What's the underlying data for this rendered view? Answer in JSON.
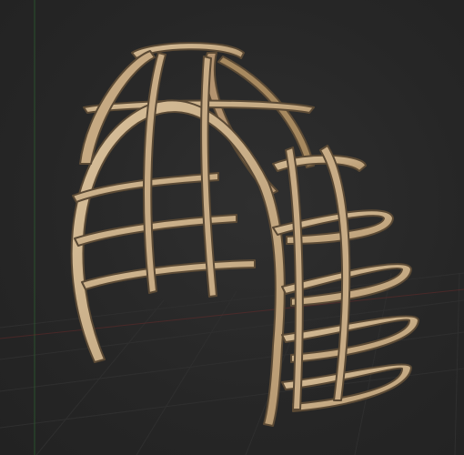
{
  "viewport": {
    "background": "#262626",
    "grid_color": "#2f2f2f",
    "axis_green": "#2f6e33",
    "axis_red": "#8a2c2c"
  },
  "model": {
    "object": "dome-frame",
    "material_color": "#cbb18e",
    "material_edge": "#6f5a3f",
    "material_shadow": "#8e7558"
  }
}
